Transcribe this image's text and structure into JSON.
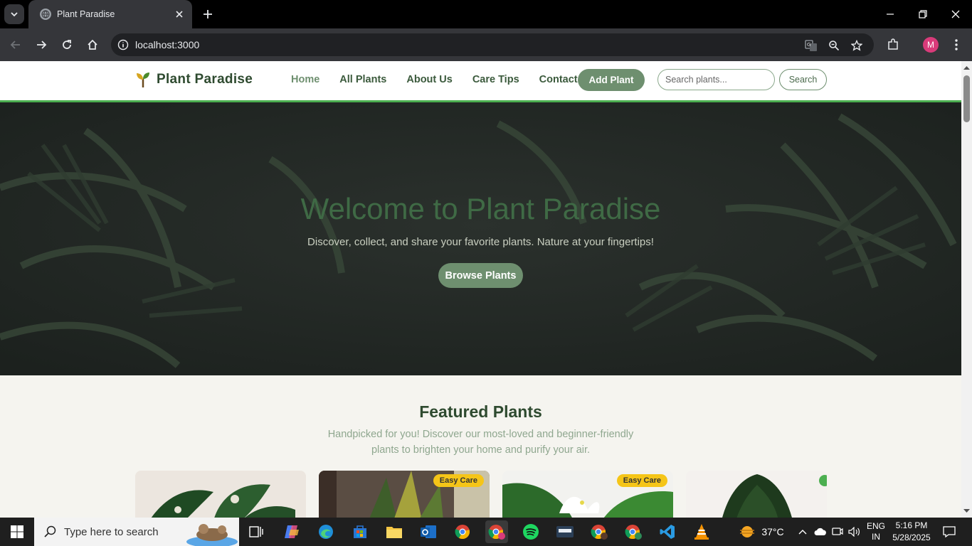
{
  "browser": {
    "tab_title": "Plant Paradise",
    "url": "localhost:3000",
    "profile_initial": "M"
  },
  "site": {
    "brand": "Plant Paradise",
    "nav": [
      {
        "label": "Home",
        "active": true
      },
      {
        "label": "All Plants",
        "active": false
      },
      {
        "label": "About Us",
        "active": false
      },
      {
        "label": "Care Tips",
        "active": false
      },
      {
        "label": "Contact",
        "active": false
      }
    ],
    "add_plant": "Add Plant",
    "search_placeholder": "Search plants...",
    "search_button": "Search"
  },
  "hero": {
    "title": "Welcome to Plant Paradise",
    "subtitle": "Discover, collect, and share your favorite plants. Nature at your fingertips!",
    "cta": "Browse Plants"
  },
  "featured": {
    "title": "Featured Plants",
    "subtitle": "Handpicked for you! Discover our most-loved and beginner-friendly plants to brighten your home and purify your air.",
    "cards": [
      {
        "badge": ""
      },
      {
        "badge": "Easy Care"
      },
      {
        "badge": "Easy Care"
      },
      {
        "badge": ""
      }
    ]
  },
  "taskbar": {
    "search_placeholder": "Type here to search",
    "weather": "37°C",
    "lang_line1": "ENG",
    "lang_line2": "IN",
    "time": "5:16 PM",
    "date": "5/28/2025"
  },
  "colors": {
    "brand_green": "#6e8f6f",
    "header_border": "#4caf50",
    "badge": "#f5c518"
  }
}
